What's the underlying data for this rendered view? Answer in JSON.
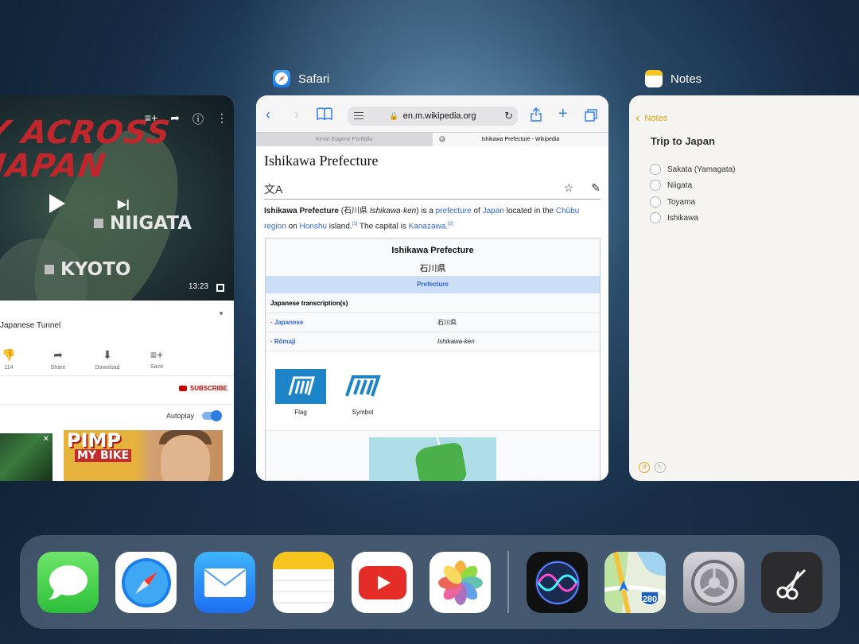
{
  "switcher": {
    "safari_label": "Safari",
    "notes_label": "Notes"
  },
  "youtube": {
    "video_title_art": "Y ACROSS\nJAPAN",
    "city_niigata": "NIIGATA",
    "city_kyoto": "KYOTO",
    "duration": "13:23",
    "subtitle": "Japanese Tunnel",
    "actions": [
      {
        "label": "114"
      },
      {
        "label": "Share"
      },
      {
        "label": "Download"
      },
      {
        "label": "Save"
      }
    ],
    "subscribe": "SUBSCRIBE",
    "autoplay": "Autoplay",
    "thumb2_line1": "PIMP",
    "thumb2_line2": "MY BIKE"
  },
  "safari": {
    "url": "en.m.wikipedia.org",
    "tabs": [
      {
        "label": "Kevin Eugene Portfolio"
      },
      {
        "label": "Ishikawa Prefecture - Wikipedia"
      }
    ],
    "page_title": "Ishikawa Prefecture",
    "intro": {
      "bold": "Ishikawa Prefecture",
      "p1": " (石川県 ",
      "italic": "Ishikawa-ken",
      "p2": ") is a ",
      "link1": "prefecture",
      "p3": " of ",
      "link2": "Japan",
      "p4": " located in the ",
      "link3": "Chūbu region",
      "p5": " on ",
      "link4": "Honshu",
      "p6": " island.",
      "sup1": "[1]",
      "p7": " The capital is ",
      "link5": "Kanazawa",
      "p8": ".",
      "sup2": "[2]"
    },
    "infobox": {
      "title": "Ishikawa Prefecture",
      "subtitle": "石川県",
      "band": "Prefecture",
      "section": "Japanese transcription(s)",
      "rows": [
        {
          "key": "· Japanese",
          "value": "石川県"
        },
        {
          "key": "· Rōmaji",
          "value": "Ishikawa-ken"
        }
      ],
      "flag_label": "Flag",
      "symbol_label": "Symbol"
    }
  },
  "notes": {
    "back_label": "Notes",
    "title": "Trip to Japan",
    "items": [
      {
        "label": "Sakata (Yamagata)"
      },
      {
        "label": "Niigata"
      },
      {
        "label": "Toyama"
      },
      {
        "label": "Ishikawa"
      }
    ]
  },
  "dock": {
    "maps_shield": "280"
  },
  "colors": {
    "safari_blue": "#2f7cf6",
    "notes_accent": "#e1a41d",
    "youtube_red": "#cc0000",
    "wiki_link": "#3366cc"
  }
}
